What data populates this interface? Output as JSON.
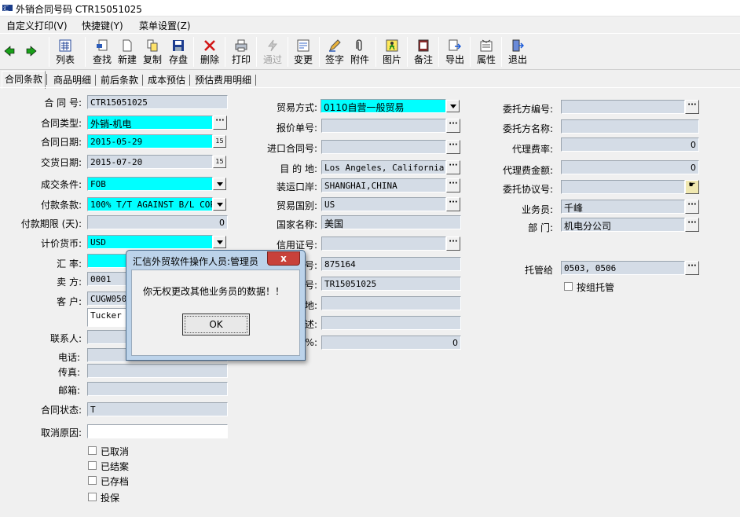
{
  "window": {
    "title": "外销合同号码  CTR15051025"
  },
  "menu": [
    "自定义打印(V)",
    "快捷键(Y)",
    "菜单设置(Z)"
  ],
  "toolbar": {
    "list": "列表",
    "find": "查找",
    "new": "新建",
    "copy": "复制",
    "save": "存盘",
    "delete": "删除",
    "print": "打印",
    "pass": "通过",
    "change": "变更",
    "sign": "签字",
    "attach": "附件",
    "picture": "图片",
    "note": "备注",
    "export": "导出",
    "props": "属性",
    "exit": "退出"
  },
  "tabs": [
    "合同条款",
    "商品明细",
    "前后条款",
    "成本预估",
    "预估费用明细"
  ],
  "left": {
    "contract_no_label": "合 同 号:",
    "contract_no": "CTR15051025",
    "type_label": "合同类型:",
    "type": "外销-机电",
    "date_label": "合同日期:",
    "date": "2015-05-29",
    "delivery_label": "交货日期:",
    "delivery": "2015-07-20",
    "deal_label": "成交条件:",
    "deal": "FOB",
    "pay_label": "付款条款:",
    "pay": "100% T/T AGAINST B/L COPY",
    "payterm_label": "付款期限 (天):",
    "payterm": "0",
    "currency_label": "计价货币:",
    "currency": "USD",
    "rate_label": "汇  率:",
    "rate": "",
    "seller_label": "卖  方:",
    "seller": "0001",
    "customer_label": "客  户:",
    "customer_code": "CUGW0500",
    "customer_name": "Tucker I",
    "contact_label": "联系人:",
    "contact": "",
    "phone_label": "电话:",
    "phone": "",
    "fax_label": "传真:",
    "fax": "",
    "email_label": "邮箱:",
    "email": "",
    "status_label": "合同状态:",
    "status": "T",
    "cancel_label": "取消原因:",
    "cancel": "",
    "checks": [
      "已取消",
      "已结案",
      "已存档",
      "投保"
    ]
  },
  "mid": {
    "trade_label": "贸易方式:",
    "trade": "0110自营一般贸易",
    "quote_label": "报价单号:",
    "quote": "",
    "import_label": "进口合同号:",
    "import": "",
    "dest_label": "目 的 地:",
    "dest": "Los Angeles, California",
    "port_label": "装运口岸:",
    "port": "SHANGHAI,CHINA",
    "country_label": "贸易国别:",
    "country": "US",
    "nation_label": "国家名称:",
    "nation": "美国",
    "lc_label": "信用证号:",
    "lc": "",
    "f1_label": "号:",
    "f1": "875164",
    "f2_label": "号:",
    "f2": "TR15051025",
    "f3_label": "地:",
    "f3": "",
    "f4_label": "述:",
    "f4": "",
    "f5_label": "%:",
    "f5": "0"
  },
  "right": {
    "client_no_label": "委托方编号:",
    "client_no": "",
    "client_name_label": "委托方名称:",
    "client_name": "",
    "agent_rate_label": "代理费率:",
    "agent_rate": "0",
    "agent_amt_label": "代理费金额:",
    "agent_amt": "0",
    "agreement_label": "委托协议号:",
    "agreement": "",
    "salesman_label": "业务员:",
    "salesman": "千峰",
    "dept_label": "部  门:",
    "dept": "机电分公司",
    "custody_label": "托管给",
    "custody": "0503, 0506",
    "group_label": "按组托管"
  },
  "dialog": {
    "title": "汇信外贸软件操作人员:管理员",
    "close": "x",
    "message": "你无权更改其他业务员的数据！！",
    "ok": "OK"
  }
}
